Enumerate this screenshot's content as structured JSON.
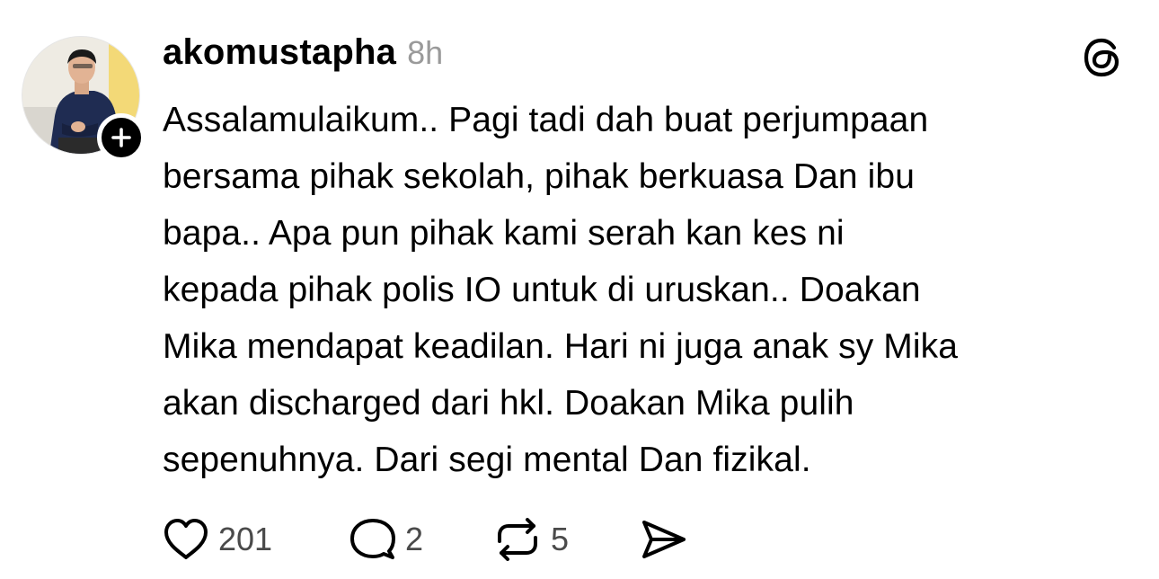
{
  "post": {
    "author": {
      "username": "akomustapha",
      "avatar_icon": "profile-photo",
      "follow_icon": "plus-icon"
    },
    "timestamp": "8h",
    "app_icon": "threads-logo",
    "text_lines": [
      "Assalamulaikum.. Pagi tadi dah buat perjumpaan",
      "bersama pihak sekolah, pihak berkuasa Dan ibu",
      "bapa.. Apa pun pihak kami serah kan kes ni",
      "kepada pihak polis IO untuk di uruskan.. Doakan",
      "Mika mendapat keadilan. Hari ni juga anak sy Mika",
      "akan discharged dari hkl. Doakan Mika pulih",
      "sepenuhnya. Dari segi mental Dan fizikal."
    ],
    "actions": {
      "like": {
        "icon": "heart-icon",
        "count": "201"
      },
      "reply": {
        "icon": "comment-icon",
        "count": "2"
      },
      "repost": {
        "icon": "repost-icon",
        "count": "5"
      },
      "share": {
        "icon": "send-icon"
      }
    }
  },
  "colors": {
    "text": "#000000",
    "muted": "#9a9a9a",
    "count": "#4a4a4a",
    "background": "#ffffff"
  }
}
